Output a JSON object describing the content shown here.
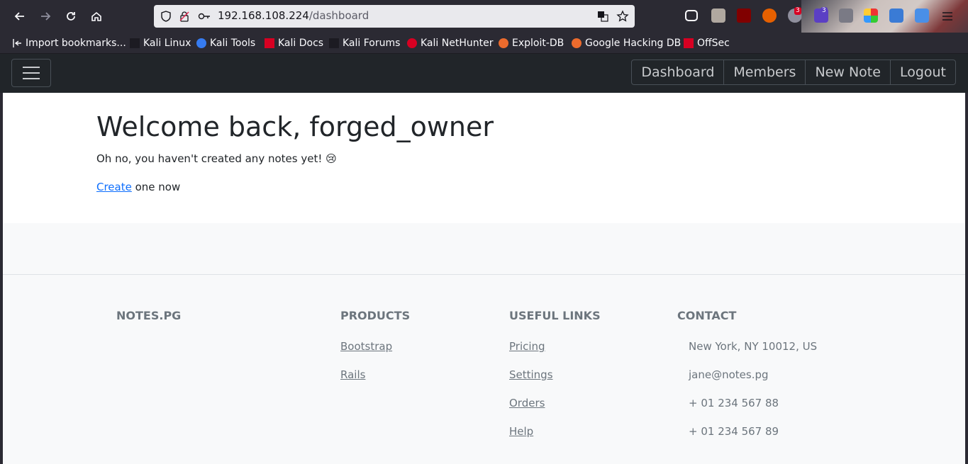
{
  "browser": {
    "url_host": "192.168.108.224",
    "url_path": "/dashboard",
    "badges": [
      "3",
      "3"
    ],
    "bookmarks": [
      {
        "label": "Import bookmarks...",
        "icon": "import-icon"
      },
      {
        "label": "Kali Linux",
        "icon": "kali-dragon-icon"
      },
      {
        "label": "Kali Tools",
        "icon": "kali-tools-icon"
      },
      {
        "label": "Kali Docs",
        "icon": "kali-docs-icon"
      },
      {
        "label": "Kali Forums",
        "icon": "kali-forums-icon"
      },
      {
        "label": "Kali NetHunter",
        "icon": "nethunter-icon"
      },
      {
        "label": "Exploit-DB",
        "icon": "exploit-db-icon"
      },
      {
        "label": "Google Hacking DB",
        "icon": "ghdb-icon"
      },
      {
        "label": "OffSec",
        "icon": "offsec-icon"
      }
    ]
  },
  "navbar": {
    "links": [
      "Dashboard",
      "Members",
      "New Note",
      "Logout"
    ]
  },
  "main": {
    "heading": "Welcome back, forged_owner",
    "empty_message": "Oh no, you haven't created any notes yet! 😢",
    "create_link": "Create",
    "create_suffix": " one now"
  },
  "footer": {
    "brand": "NOTES.PG",
    "products": {
      "title": "PRODUCTS",
      "items": [
        "Bootstrap",
        "Rails"
      ]
    },
    "useful_links": {
      "title": "USEFUL LINKS",
      "items": [
        "Pricing",
        "Settings",
        "Orders",
        "Help"
      ]
    },
    "contact": {
      "title": "CONTACT",
      "items": [
        "New York, NY 10012, US",
        "jane@notes.pg",
        "+ 01 234 567 88",
        "+ 01 234 567 89"
      ]
    }
  },
  "colors": {
    "navbar_bg": "#212529",
    "link_blue": "#0d6efd",
    "footer_text": "#6c757d",
    "footer_bg": "#f8f9fa"
  }
}
